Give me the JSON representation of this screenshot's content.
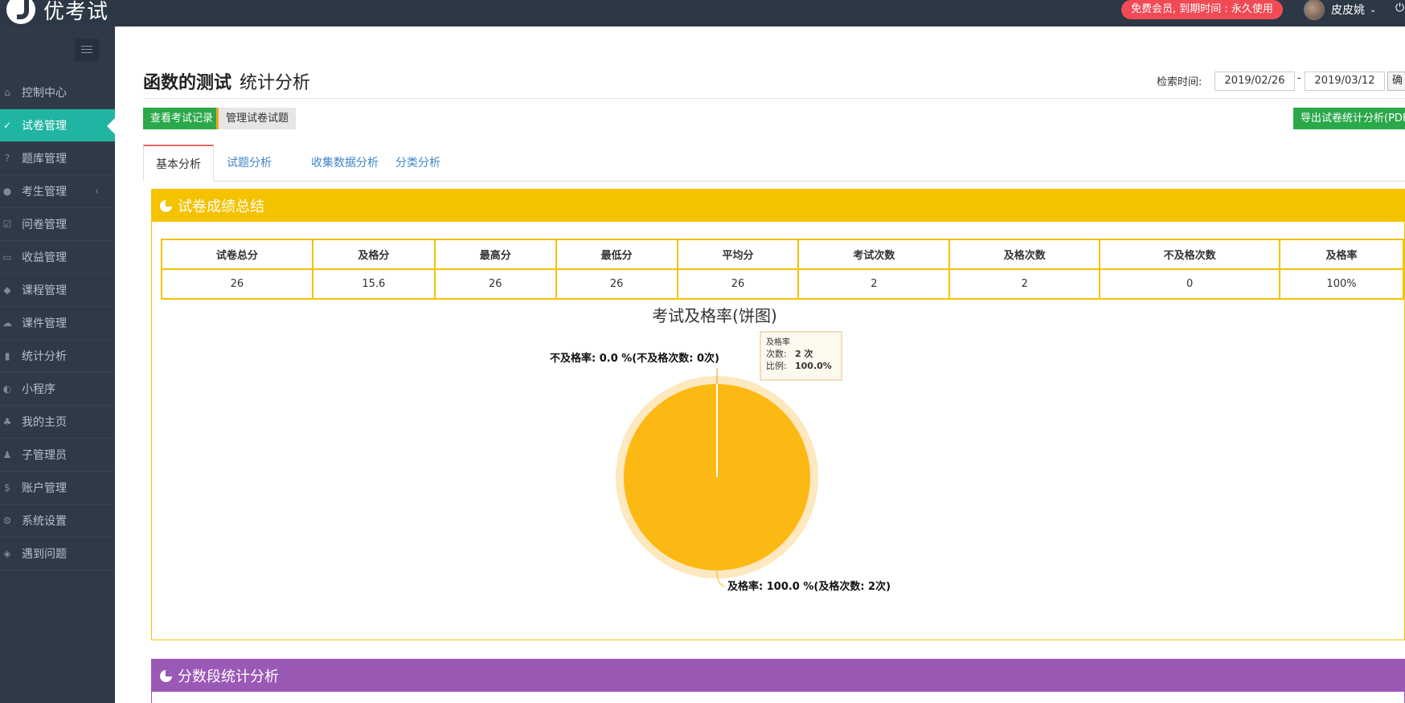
{
  "app": {
    "logo_text": "优考试"
  },
  "topbar": {
    "member_badge": "免费会员, 到期时间 : 永久使用",
    "user_name": "皮皮姚",
    "user_menu_icon": "chevron-down-icon",
    "power_icon": "power-icon"
  },
  "sidebar": {
    "items": [
      {
        "label": "控制中心",
        "icon": "home-icon"
      },
      {
        "label": "试卷管理",
        "icon": "check-circle-icon",
        "active": true
      },
      {
        "label": "题库管理",
        "icon": "question-circle-icon"
      },
      {
        "label": "考生管理",
        "icon": "user-icon",
        "has_arrow": true
      },
      {
        "label": "问卷管理",
        "icon": "checkbox-icon"
      },
      {
        "label": "收益管理",
        "icon": "credit-card-icon"
      },
      {
        "label": "课程管理",
        "icon": "graduation-cap-icon"
      },
      {
        "label": "课件管理",
        "icon": "cloud-upload-icon"
      },
      {
        "label": "统计分析",
        "icon": "bar-chart-icon"
      },
      {
        "label": "小程序",
        "icon": "wechat-icon"
      },
      {
        "label": "我的主页",
        "icon": "leaf-icon"
      },
      {
        "label": "子管理员",
        "icon": "users-icon"
      },
      {
        "label": "账户管理",
        "icon": "dollar-icon"
      },
      {
        "label": "系统设置",
        "icon": "gear-icon"
      },
      {
        "label": "遇到问题",
        "icon": "tag-icon"
      }
    ]
  },
  "page": {
    "title_main": "函数的测试",
    "title_sub": "统计分析",
    "search_label": "检索时间:",
    "date_from": "2019/02/26",
    "date_sep": "-",
    "date_to": "2019/03/12",
    "confirm_label": "确定",
    "btn_view_records": "查看考试记录",
    "btn_manage_questions": "管理试卷试题",
    "btn_export": "导出试卷统计分析(PDF)"
  },
  "tabs": [
    "基本分析",
    "试题分析",
    "收集数据分析",
    "分类分析"
  ],
  "summary_panel": {
    "title": "试卷成绩总结",
    "color": "#f5c200",
    "headers": [
      "试卷总分",
      "及格分",
      "最高分",
      "最低分",
      "平均分",
      "考试次数",
      "及格次数",
      "不及格次数",
      "及格率"
    ],
    "values": [
      "26",
      "15.6",
      "26",
      "26",
      "26",
      "2",
      "2",
      "0",
      "100%"
    ]
  },
  "chart_data": {
    "type": "pie",
    "title": "考试及格率(饼图)",
    "slices": [
      {
        "name": "及格率",
        "value": 2,
        "percent": 100.0,
        "label": "及格率: 100.0 %(及格次数: 2次)",
        "color": "#fdb913"
      },
      {
        "name": "不及格率",
        "value": 0,
        "percent": 0.0,
        "label": "不及格率: 0.0 %(不及格次数: 0次)",
        "color": "#f7931e"
      }
    ],
    "tooltip": {
      "title": "及格率",
      "count_label": "次数:",
      "count_value": "2 次",
      "ratio_label": "比例:",
      "ratio_value": "100.0%"
    }
  },
  "score_panel": {
    "title": "分数段统计分析",
    "color": "#9b59b6"
  }
}
